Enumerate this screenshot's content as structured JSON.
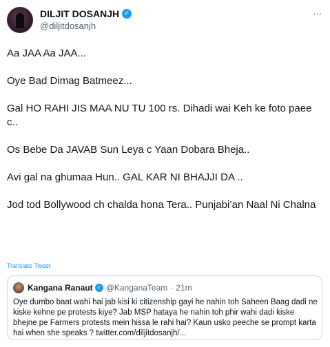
{
  "author": {
    "name": "DILJIT DOSANJH",
    "handle": "@diljitdosanjh",
    "verified_icon": "verified-badge-icon",
    "menu": "…"
  },
  "tweet": {
    "paragraphs": [
      "Aa JAA Aa JAA...",
      "Oye Bad Dimag Batmeez...",
      "Gal HO RAHI JIS MAA NU TU 100 rs. Dihadi wai Keh ke foto paee c..",
      "Os Bebe Da JAVAB Sun Leya c Yaan Dobara Bheja..",
      "Avi gal na ghumaa Hun.. GAL KAR NI BHAJJI DA ..",
      "Jod tod Bollywood ch chalda hona Tera.. Punjabi’an Naal Ni Chalna"
    ],
    "translate_label": "Translate Tweet"
  },
  "quoted_tweet": {
    "name": "Kangana Ranaut",
    "handle": "@KanganaTeam",
    "separator": "·",
    "time": "21m",
    "text": "Oye dumbo baat wahi hai jab kisi ki citizenship gayi he nahin toh Saheen Baag dadi ne kiske kehne pe protests kiye? Jab MSP hataya he nahin toh phir wahi dadi kiske bhejne pe Farmers protests mein hissa le rahi hai? Kaun usko peeche se prompt karta hai when she speaks ? twitter.com/diljitdosanjh/..."
  },
  "colors": {
    "accent": "#1d9bf0",
    "text": "#0f1419",
    "secondary": "#536471",
    "border": "#cfd9de"
  }
}
